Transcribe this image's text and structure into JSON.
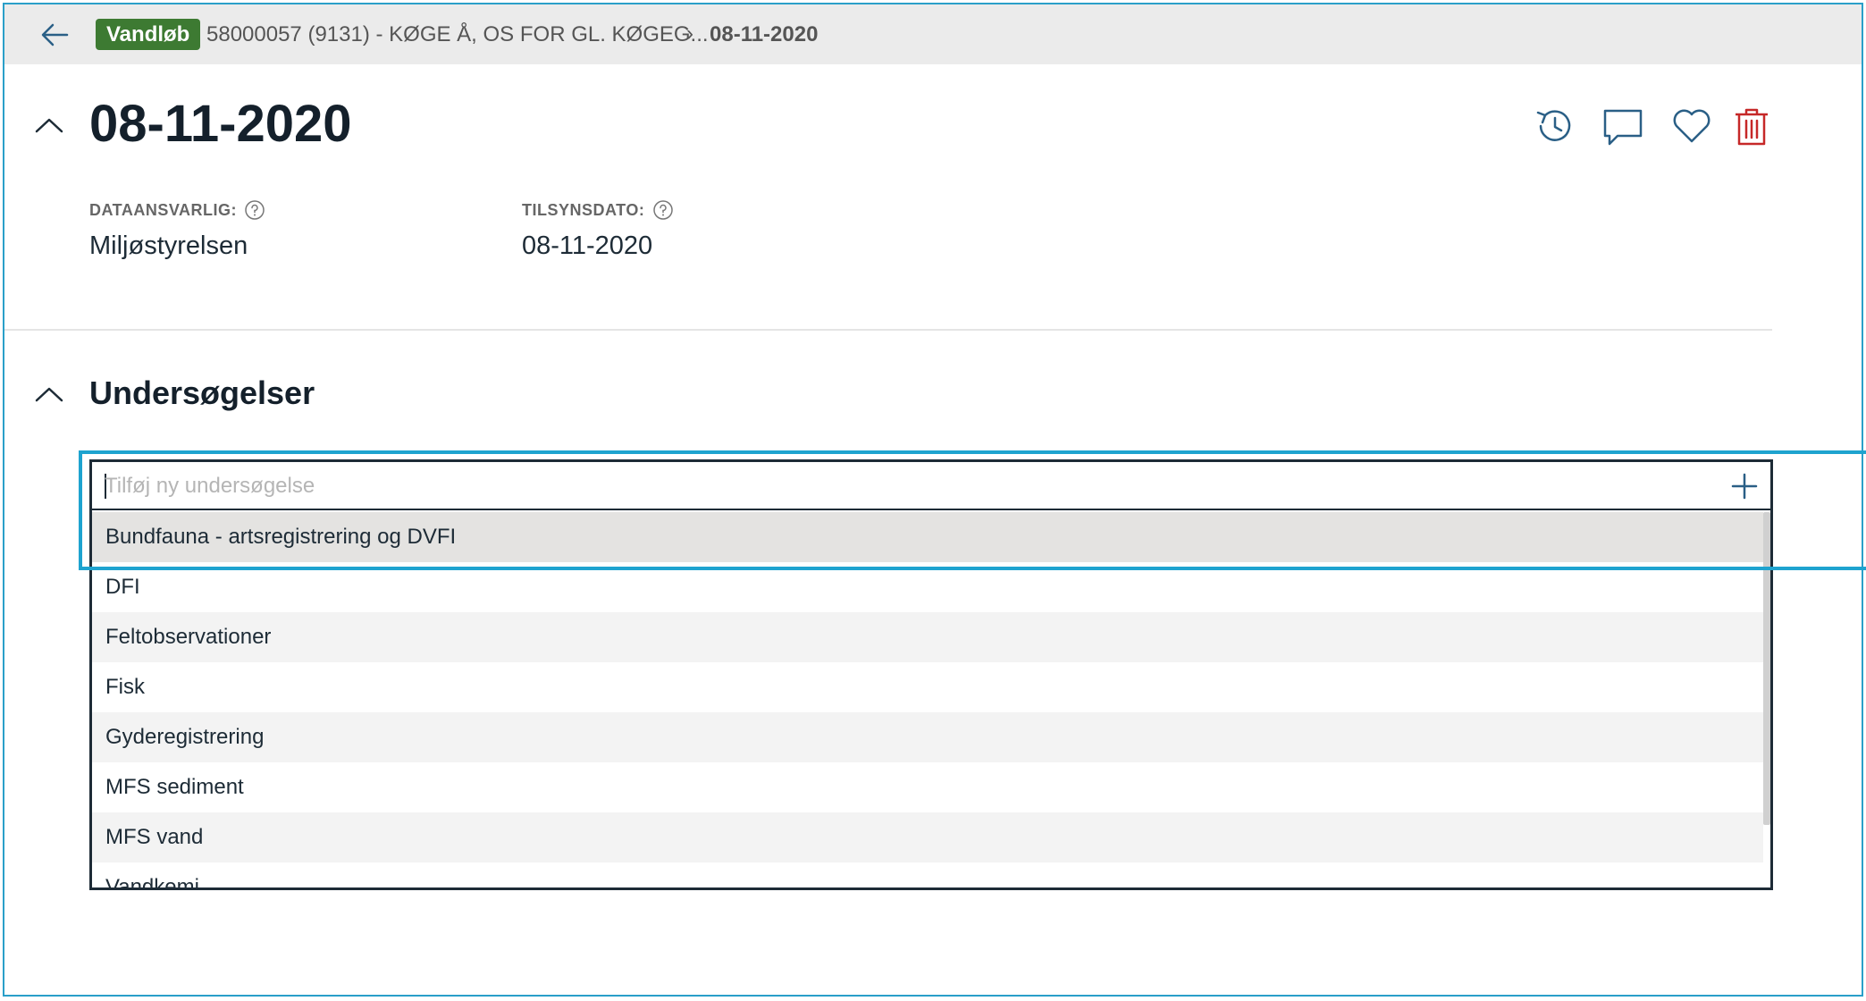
{
  "breadcrumb": {
    "badge": "Vandløb",
    "parent": "58000057 (9131) - KØGE Å, OS FOR GL. KØGEG...",
    "separator": "›",
    "current": "08-11-2020"
  },
  "header": {
    "title": "08-11-2020"
  },
  "fields": {
    "dataansvarlig": {
      "label": "DATAANSVARLIG:",
      "value": "Miljøstyrelsen"
    },
    "tilsynsdato": {
      "label": "TILSYNSDATO:",
      "value": "08-11-2020"
    }
  },
  "section": {
    "title": "Undersøgelser"
  },
  "search": {
    "placeholder": "Tilføj ny undersøgelse",
    "value": ""
  },
  "options": [
    "Bundfauna - artsregistrering og DVFI",
    "DFI",
    "Feltobservationer",
    "Fisk",
    "Gyderegistrering",
    "MFS sediment",
    "MFS vand",
    "Vandkemi"
  ],
  "colors": {
    "badge": "#3d7a32",
    "delete_icon": "#c62828",
    "icon": "#2a5f86",
    "highlight": "#1ea3cf"
  },
  "icons": {
    "back": "arrow-left-icon",
    "collapse": "chevron-up-icon",
    "history": "history-icon",
    "comment": "comment-icon",
    "favorite": "heart-icon",
    "delete": "trash-icon",
    "help": "help-icon",
    "add": "plus-icon"
  }
}
